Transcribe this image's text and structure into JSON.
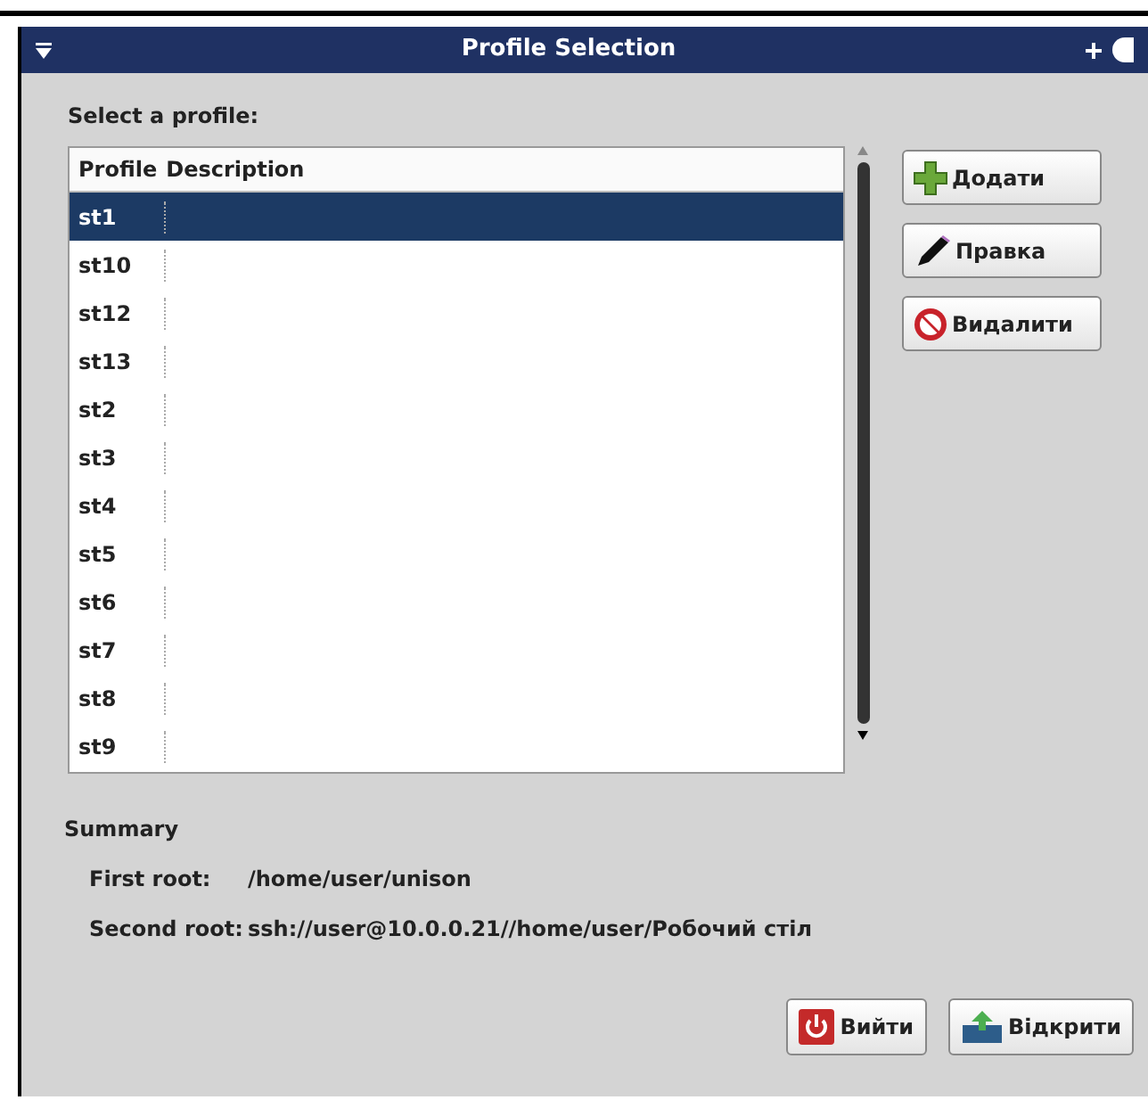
{
  "window": {
    "title": "Profile Selection"
  },
  "prompt": "Select a profile:",
  "table": {
    "columns": [
      "Profile",
      "Description"
    ],
    "rows": [
      {
        "profile": "st1",
        "selected": true
      },
      {
        "profile": "st10",
        "selected": false
      },
      {
        "profile": "st12",
        "selected": false
      },
      {
        "profile": "st13",
        "selected": false
      },
      {
        "profile": "st2",
        "selected": false
      },
      {
        "profile": "st3",
        "selected": false
      },
      {
        "profile": "st4",
        "selected": false
      },
      {
        "profile": "st5",
        "selected": false
      },
      {
        "profile": "st6",
        "selected": false
      },
      {
        "profile": "st7",
        "selected": false
      },
      {
        "profile": "st8",
        "selected": false
      },
      {
        "profile": "st9",
        "selected": false
      }
    ]
  },
  "side_buttons": [
    {
      "kind": "add",
      "label": "Додати"
    },
    {
      "kind": "edit",
      "label": "Правка"
    },
    {
      "kind": "delete",
      "label": "Видалити"
    }
  ],
  "summary": {
    "title": "Summary",
    "items": [
      {
        "label": "First root:",
        "value": "/home/user/unison"
      },
      {
        "label": "Second root:",
        "value": "ssh://user@10.0.0.21//home/user/Робочий стіл"
      }
    ]
  },
  "bottom_buttons": [
    {
      "kind": "quit",
      "label": "Вийти"
    },
    {
      "kind": "open",
      "label": "Відкрити"
    }
  ]
}
